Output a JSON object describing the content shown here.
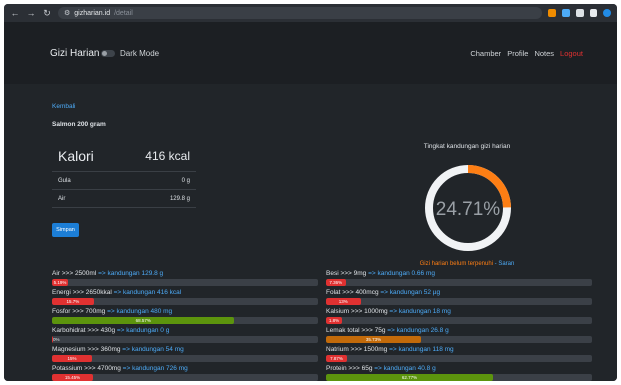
{
  "browser": {
    "host": "gizharian.id",
    "path": "/detail"
  },
  "nav": {
    "brand": "Gizi Harian",
    "dark_mode_label": "Dark Mode",
    "links": [
      "Chamber",
      "Profile",
      "Notes"
    ],
    "logout": "Logout"
  },
  "detail": {
    "back_link": "Kembali",
    "food_name": "Salmon 200 gram",
    "calorie_label": "Kalori",
    "calorie_value": "416 kcal",
    "rows": [
      {
        "label": "Gula",
        "value": "0 g"
      },
      {
        "label": "Air",
        "value": "129.8 g"
      }
    ],
    "save_button": "Simpan"
  },
  "gauge": {
    "title": "Tingkat kandungan gizi harian",
    "percent_text": "24.71%",
    "percent": 24.71,
    "status": "Gizi harian belum terpenuhi",
    "sep": " - ",
    "advice": "Saran",
    "track_color": "#f1f3f5",
    "fill_color": "#fd7e14",
    "text_color": "#9aa0a6"
  },
  "nutrients_left": [
    {
      "label": "Air >>> 2500ml",
      "sep": "=>",
      "amount": "kandungan 129.8 g",
      "percent": 5.19,
      "bar_text": "5.19%",
      "color": "#e03131"
    },
    {
      "label": "Energi >>> 2650kkal",
      "sep": "=>",
      "amount": "kandungan 416 kcal",
      "percent": 15.7,
      "bar_text": "15.7%",
      "color": "#e03131"
    },
    {
      "label": "Fosfor >>> 700mg",
      "sep": "=>",
      "amount": "kandungan 480 mg",
      "percent": 68.57,
      "bar_text": "68.57%",
      "color": "#5c940d"
    },
    {
      "label": "Karbohidrat >>> 430g",
      "sep": "=>",
      "amount": "kandungan 0 g",
      "percent": 0,
      "bar_text": "0%",
      "color": "#e03131"
    },
    {
      "label": "Magnesium >>> 360mg",
      "sep": "=>",
      "amount": "kandungan 54 mg",
      "percent": 15,
      "bar_text": "15%",
      "color": "#e03131"
    },
    {
      "label": "Potassium >>> 4700mg",
      "sep": "=>",
      "amount": "kandungan 726 mg",
      "percent": 15.45,
      "bar_text": "15.45%",
      "color": "#e03131"
    }
  ],
  "nutrients_right": [
    {
      "label": "Besi >>> 9mg",
      "sep": "=>",
      "amount": "kandungan 0.66 mg",
      "percent": 7.36,
      "bar_text": "7.36%",
      "color": "#e03131"
    },
    {
      "label": "Folat >>> 400mcg",
      "sep": "=>",
      "amount": "kandungan 52 µg",
      "percent": 13,
      "bar_text": "13%",
      "color": "#e03131"
    },
    {
      "label": "Kalsium >>> 1000mg",
      "sep": "=>",
      "amount": "kandungan 18 mg",
      "percent": 1.8,
      "bar_text": "1.8%",
      "color": "#e03131"
    },
    {
      "label": "Lemak total >>> 75g",
      "sep": "=>",
      "amount": "kandungan 26.8 g",
      "percent": 35.73,
      "bar_text": "35.73%",
      "color": "#c26a0a"
    },
    {
      "label": "Natrium >>> 1500mg",
      "sep": "=>",
      "amount": "kandungan 118 mg",
      "percent": 7.87,
      "bar_text": "7.87%",
      "color": "#e03131"
    },
    {
      "label": "Protein >>> 65g",
      "sep": "=>",
      "amount": "kandungan 40.8 g",
      "percent": 62.77,
      "bar_text": "62.77%",
      "color": "#5c940d"
    }
  ]
}
